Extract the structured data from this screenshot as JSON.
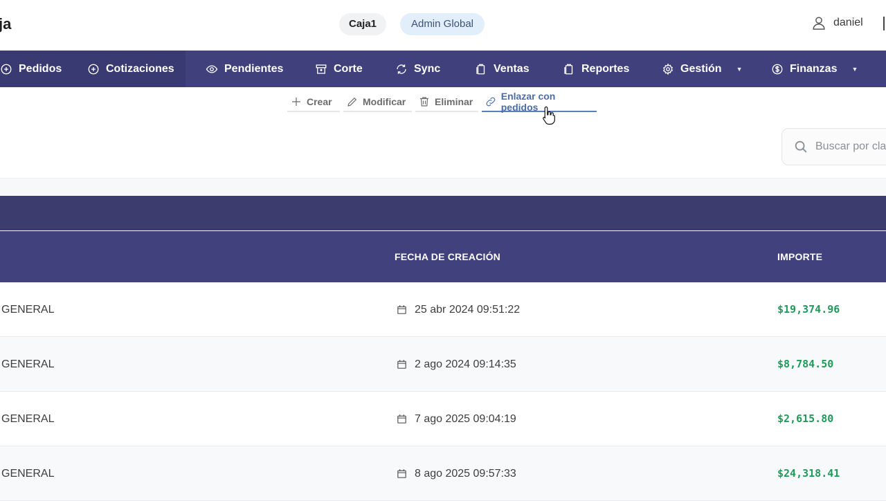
{
  "header": {
    "brand": "ja",
    "pill_caja": "Caja1",
    "pill_admin": "Admin Global",
    "user_name": "daniel"
  },
  "nav": {
    "items": [
      {
        "label": "Pedidos",
        "icon": "plus-circle-icon"
      },
      {
        "label": "Cotizaciones",
        "icon": "plus-circle-icon"
      },
      {
        "label": "Pendientes",
        "icon": "eye-icon"
      },
      {
        "label": "Corte",
        "icon": "archive-icon"
      },
      {
        "label": "Sync",
        "icon": "sync-icon"
      },
      {
        "label": "Ventas",
        "icon": "clipboard-icon"
      },
      {
        "label": "Reportes",
        "icon": "clipboard-icon"
      },
      {
        "label": "Gestión",
        "icon": "gear-icon",
        "dropdown": true
      },
      {
        "label": "Finanzas",
        "icon": "dollar-circle-icon",
        "dropdown": true
      }
    ]
  },
  "toolbar": {
    "crear": "Crear",
    "modificar": "Modificar",
    "eliminar": "Eliminar",
    "enlazar": "Enlazar con pedidos"
  },
  "search": {
    "placeholder": "Buscar por cla"
  },
  "table": {
    "columns": {
      "fecha": "FECHA DE CREACIÓN",
      "importe": "IMPORTE"
    },
    "rows": [
      {
        "cliente": "GENERAL",
        "fecha": "25 abr 2024 09:51:22",
        "importe": "$19,374.96"
      },
      {
        "cliente": "GENERAL",
        "fecha": "2 ago 2024 09:14:35",
        "importe": "$8,784.50"
      },
      {
        "cliente": "GENERAL",
        "fecha": "7 ago 2025 09:04:19",
        "importe": "$2,615.80"
      },
      {
        "cliente": "GENERAL",
        "fecha": "8 ago 2025 09:57:33",
        "importe": "$24,318.41"
      }
    ]
  },
  "colors": {
    "nav_bg": "#40407c",
    "active_link": "#4a6ca8",
    "amount_green": "#1f9a5a"
  }
}
